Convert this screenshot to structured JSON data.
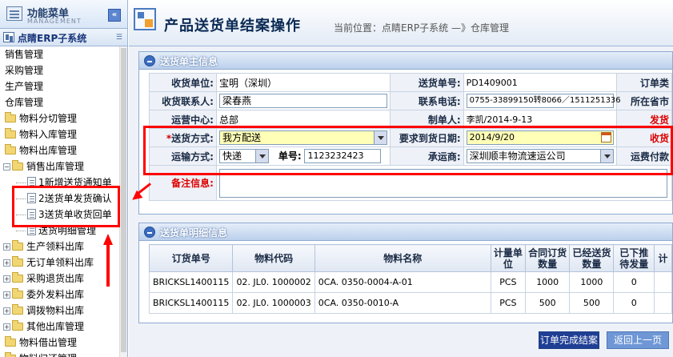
{
  "sidebar": {
    "title": "功能菜单",
    "subtitle": "MANAGEMENT",
    "system": "点睛ERP子系统",
    "items": [
      {
        "label": "销售管理",
        "level": 0,
        "kind": "plain"
      },
      {
        "label": "采购管理",
        "level": 0,
        "kind": "plain"
      },
      {
        "label": "生产管理",
        "level": 0,
        "kind": "plain"
      },
      {
        "label": "仓库管理",
        "level": 0,
        "kind": "plain"
      },
      {
        "label": "物料分切管理",
        "level": 0,
        "kind": "folder"
      },
      {
        "label": "物料入库管理",
        "level": 0,
        "kind": "folder"
      },
      {
        "label": "物料出库管理",
        "level": 0,
        "kind": "folder"
      },
      {
        "label": "销售出库管理",
        "level": 1,
        "kind": "folder-open"
      },
      {
        "label": "1新增送货通知单",
        "level": 2,
        "kind": "doc"
      },
      {
        "label": "2送货单发货确认",
        "level": 2,
        "kind": "doc"
      },
      {
        "label": "3送货单收货回单",
        "level": 2,
        "kind": "doc"
      },
      {
        "label": "送货明细管理",
        "level": 2,
        "kind": "doc"
      },
      {
        "label": "生产领料出库",
        "level": 1,
        "kind": "folder"
      },
      {
        "label": "无订单领料出库",
        "level": 1,
        "kind": "folder"
      },
      {
        "label": "采购退货出库",
        "level": 1,
        "kind": "folder"
      },
      {
        "label": "委外发料出库",
        "level": 1,
        "kind": "folder"
      },
      {
        "label": "调拨物料出库",
        "level": 1,
        "kind": "folder"
      },
      {
        "label": "其他出库管理",
        "level": 1,
        "kind": "folder"
      },
      {
        "label": "物料借出管理",
        "level": 0,
        "kind": "folder"
      },
      {
        "label": "物料归还管理",
        "level": 0,
        "kind": "folder"
      }
    ]
  },
  "header": {
    "title": "产品送货单结案操作",
    "breadcrumb": "当前位置：点睛ERP子系统 —》仓库管理"
  },
  "main_info": {
    "title": "送货单主信息",
    "rows": [
      {
        "l1": "收货单位:",
        "v1": "宝明（深圳）",
        "l2": "送货单号:",
        "v2": "PD1409001",
        "l3": "订单类"
      },
      {
        "l1": "收货联系人:",
        "v1": "梁春燕",
        "l2": "联系电话:",
        "v2": "0755-33899150转8066／1511251336",
        "l3": "所在省市"
      },
      {
        "l1": "运营中心:",
        "v1": "总部",
        "l2": "制单人:",
        "v2": "李凯/2014-9-13",
        "l3": "发货"
      }
    ],
    "delivery_method_label": "送货方式:",
    "delivery_method": "我方配送",
    "required_date_label": "要求到货日期:",
    "required_date": "2014/9/20",
    "receive_label": "收货",
    "transport_label": "运输方式:",
    "transport": "快递",
    "no_label": "单号:",
    "no_value": "1123232423",
    "carrier_label": "承运商:",
    "carrier": "深圳顺丰物流速运公司",
    "freight_label": "运费付款",
    "remark_label": "备注信息:",
    "remark": ""
  },
  "detail": {
    "title": "送货单明细信息",
    "columns": [
      "订货单号",
      "物料代码",
      "物料名称",
      "计量单位",
      "合同订货数量",
      "已经送货数量",
      "已下推待发量",
      "计"
    ],
    "rows": [
      [
        "BRICKSL1400115",
        "02. JL0. 1000002",
        "0CA. 0350-0004-A-01",
        "PCS",
        "1000",
        "1000",
        "0",
        ""
      ],
      [
        "BRICKSL1400115",
        "02. JL0. 1000003",
        "0CA. 0350-0010-A",
        "PCS",
        "500",
        "500",
        "0",
        ""
      ]
    ]
  },
  "buttons": {
    "complete": "订单完成结案",
    "back": "返回上一页"
  },
  "colors": {
    "highlight": "#ff0000",
    "accent": "#2d5fb8"
  }
}
